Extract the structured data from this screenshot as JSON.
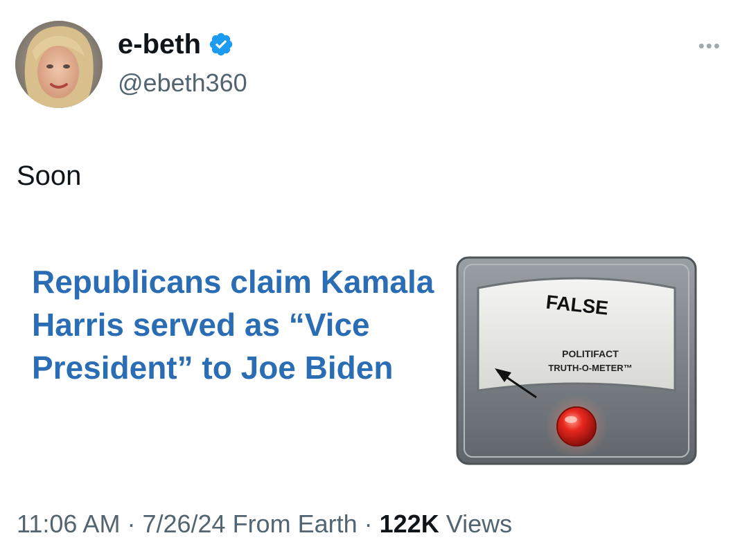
{
  "user": {
    "display_name": "e-beth",
    "handle": "@ebeth360",
    "verified": true,
    "avatar_icon": "profile-photo"
  },
  "tweet": {
    "text": "Soon",
    "more_icon": "ellipsis-icon"
  },
  "media": {
    "headline": "Republicans claim Kamala Harris served as “Vice President” to Joe Biden",
    "meter_rating": "FALSE",
    "meter_brand_line1": "POLITIFACT",
    "meter_brand_line2": "TRUTH-O-METER™"
  },
  "footer": {
    "time": "11:06 AM",
    "separator": " · ",
    "date": "7/26/24",
    "source": "From Earth",
    "views_count": "122K",
    "views_label": "Views"
  },
  "colors": {
    "headline": "#2a6db5",
    "verified": "#1d9bf0",
    "secondary_text": "#536471",
    "meter_light": "#e8271e"
  }
}
